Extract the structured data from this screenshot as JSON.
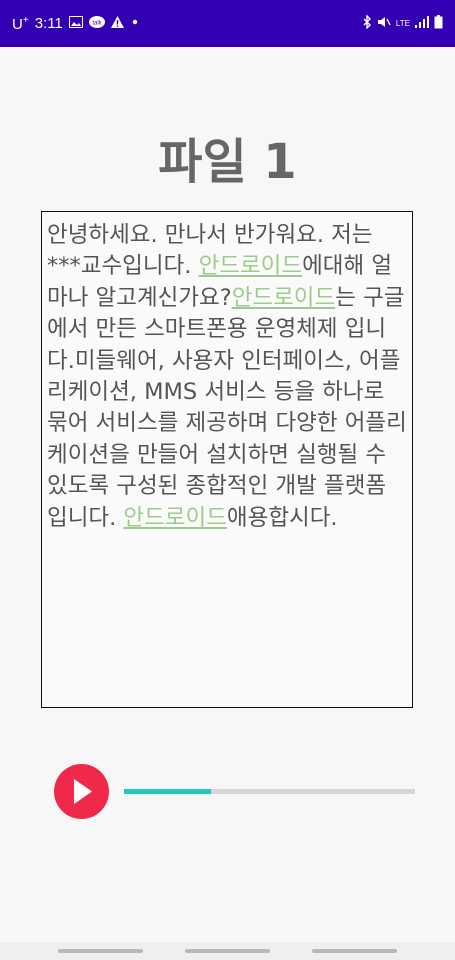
{
  "status_bar": {
    "carrier": "U",
    "carrier_sup": "+",
    "time": "3:11",
    "network_label": "LTE",
    "icons_left": [
      "gallery-icon",
      "chat-icon",
      "warning-icon",
      "dot-icon"
    ],
    "icons_right": [
      "bluetooth-icon",
      "mute-icon",
      "lte-icon",
      "signal-icon",
      "battery-icon"
    ]
  },
  "title": "파일 1",
  "content": {
    "seg1": "안녕하세요. 만나서 반가워요. 저는 ***교수입니다. ",
    "link1": "안드로이드",
    "seg2": "에대해 얼마나 알고계신가요?",
    "link2": "안드로이드",
    "seg3": "는 구글에서 만든 스마트폰용 운영체제 입니다.미들웨어, 사용자 인터페이스, 어플리케이션, MMS 서비스 등을 하나로 묶어 서비스를 제공하며 다양한 어플리케이션을 만들어 설치하면 실행될 수 있도록 구성된 종합적인 개발 플랫폼 입니다. ",
    "link3": "안드로이드",
    "seg4": "애용합시다."
  },
  "player": {
    "play_icon": "play-icon",
    "progress_fraction": 0.3,
    "colors": {
      "button": "#f0294a",
      "progress": "#1ec9bd",
      "track": "#d6d6d6"
    }
  },
  "colors": {
    "status_bar": "#3300b4",
    "link": "#9ccc8c",
    "title": "#666666"
  }
}
